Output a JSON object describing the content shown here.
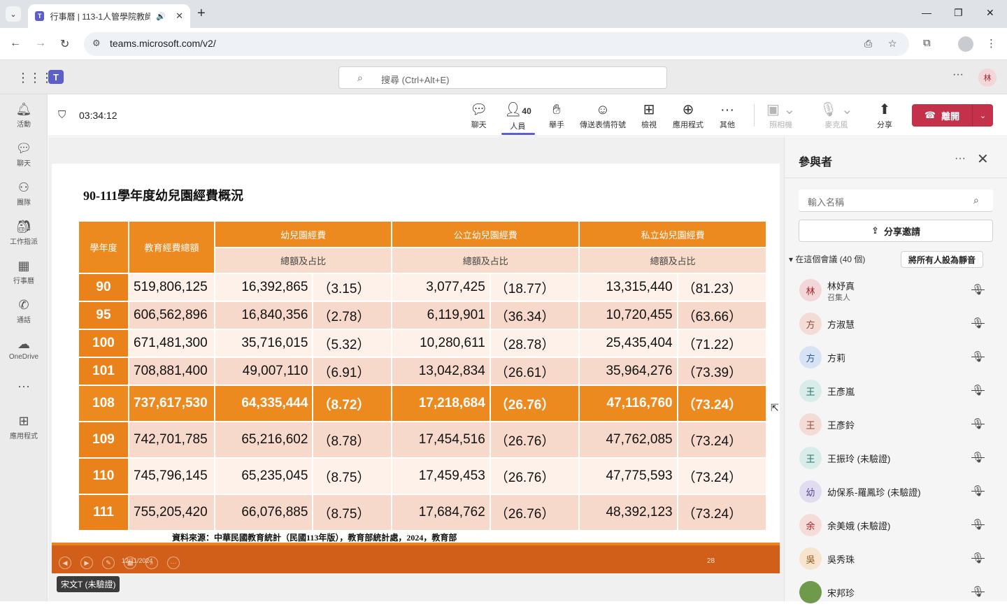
{
  "browser": {
    "tab_title": "行事曆 | 113-1人管學院教師",
    "url": "teams.microsoft.com/v2/"
  },
  "teams": {
    "search_placeholder": "搜尋 (Ctrl+Alt+E)",
    "avatar_initial": "林"
  },
  "rail": [
    {
      "label": "活動",
      "icon": "bell-icon"
    },
    {
      "label": "聊天",
      "icon": "chat-icon"
    },
    {
      "label": "團隊",
      "icon": "teams-icon"
    },
    {
      "label": "工作指派",
      "icon": "assignments-icon"
    },
    {
      "label": "行事曆",
      "icon": "calendar-icon"
    },
    {
      "label": "通話",
      "icon": "phone-icon"
    },
    {
      "label": "OneDrive",
      "icon": "cloud-icon"
    },
    {
      "label": "",
      "icon": "more-icon"
    },
    {
      "label": "應用程式",
      "icon": "apps-add-icon"
    }
  ],
  "meeting": {
    "elapsed": "03:34:12",
    "people_count": "40",
    "buttons": {
      "chat": "聊天",
      "people": "人員",
      "raise": "舉手",
      "react": "傳送表情符號",
      "view": "檢視",
      "apps": "應用程式",
      "more": "其他",
      "camera": "照相機",
      "mic": "麥克風",
      "share": "分享"
    },
    "leave": "離開"
  },
  "slide": {
    "title": "90-111學年度幼兒園經費概況",
    "headers": {
      "year": "學年度",
      "total": "教育經費總額",
      "kinder": "幼兒園經費",
      "public": "公立幼兒園經費",
      "private": "私立幼兒園經費",
      "sub": "總額及占比"
    },
    "rows": [
      {
        "year": "90",
        "total": "519,806,125",
        "k": "16,392,865",
        "kp": "（3.15）",
        "pu": "3,077,425",
        "pup": "（18.77）",
        "pr": "13,315,440",
        "prp": "（81.23）"
      },
      {
        "year": "95",
        "total": "606,562,896",
        "k": "16,840,356",
        "kp": "（2.78）",
        "pu": "6,119,901",
        "pup": "（36.34）",
        "pr": "10,720,455",
        "prp": "（63.66）"
      },
      {
        "year": "100",
        "total": "671,481,300",
        "k": "35,716,015",
        "kp": "（5.32）",
        "pu": "10,280,611",
        "pup": "（28.78）",
        "pr": "25,435,404",
        "prp": "（71.22）"
      },
      {
        "year": "101",
        "total": "708,881,400",
        "k": "49,007,110",
        "kp": "（6.91）",
        "pu": "13,042,834",
        "pup": "（26.61）",
        "pr": "35,964,276",
        "prp": "（73.39）"
      },
      {
        "year": "108",
        "total": "737,617,530",
        "k": "64,335,444",
        "kp": "（8.72）",
        "pu": "17,218,684",
        "pup": "（26.76）",
        "pr": "47,116,760",
        "prp": "（73.24）"
      },
      {
        "year": "109",
        "total": "742,701,785",
        "k": "65,216,602",
        "kp": "（8.78）",
        "pu": "17,454,516",
        "pup": "（26.76）",
        "pr": "47,762,085",
        "prp": "（73.24）"
      },
      {
        "year": "110",
        "total": "745,796,145",
        "k": "65,235,045",
        "kp": "（8.75）",
        "pu": "17,459,453",
        "pup": "（26.76）",
        "pr": "47,775,593",
        "prp": "（73.24）"
      },
      {
        "year": "111",
        "total": "755,205,420",
        "k": "66,076,885",
        "kp": "（8.75）",
        "pu": "17,684,762",
        "pup": "（26.76）",
        "pr": "48,392,123",
        "prp": "（73.24）"
      }
    ],
    "source": "資料來源：中華民國教育統計（民國113年版），教育部統計處，2024，教育部",
    "footer_date": "12/11/2024",
    "page_number": "28"
  },
  "presenter_name": "宋文T (未驗證)",
  "panel": {
    "title": "參與者",
    "search_placeholder": "輸入名稱",
    "share_invite": "分享邀請",
    "section_label": "在這個會議 (40 個)",
    "mute_all": "將所有人設為靜音",
    "participants": [
      {
        "initial": "林",
        "name": "林妤真",
        "role": "召集人",
        "bg": "#f3d6d8",
        "fg": "#a4262c"
      },
      {
        "initial": "方",
        "name": "方淑慧",
        "role": "",
        "bg": "#f4dcd6",
        "fg": "#8e4a3a"
      },
      {
        "initial": "方",
        "name": "方莉",
        "role": "",
        "bg": "#d6e3f4",
        "fg": "#2d5a8e"
      },
      {
        "initial": "王",
        "name": "王彥嵐",
        "role": "",
        "bg": "#d8ece9",
        "fg": "#2c6e66"
      },
      {
        "initial": "王",
        "name": "王彥鈴",
        "role": "",
        "bg": "#f4dcd6",
        "fg": "#8e4a3a"
      },
      {
        "initial": "王",
        "name": "王振玲 (未驗證)",
        "role": "",
        "bg": "#d8ece9",
        "fg": "#2c6e66"
      },
      {
        "initial": "幼",
        "name": "幼保系-羅鳳珍 (未驗證)",
        "role": "",
        "bg": "#e2dcf1",
        "fg": "#5b4a8e"
      },
      {
        "initial": "余",
        "name": "余美娥 (未驗證)",
        "role": "",
        "bg": "#f6dcd8",
        "fg": "#a4262c"
      },
      {
        "initial": "吳",
        "name": "吳秀珠",
        "role": "",
        "bg": "#f6e4cc",
        "fg": "#8a5a1c"
      },
      {
        "initial": "",
        "name": "宋邦珍",
        "role": "",
        "bg": "#6f9a4c",
        "fg": "#ffffff"
      }
    ]
  }
}
